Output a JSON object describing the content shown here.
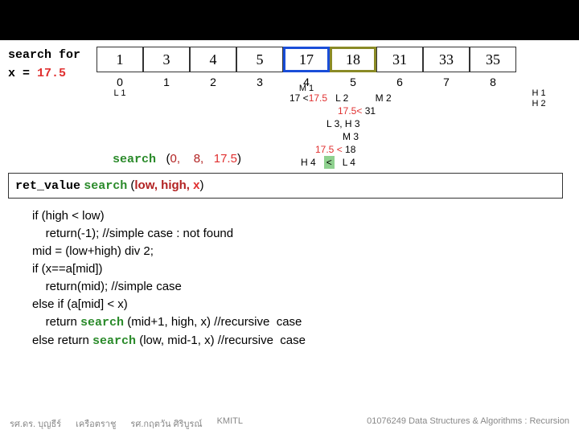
{
  "header": {
    "search_for": "search for",
    "x_label": "x",
    "equals": " = ",
    "x_value": "17.5"
  },
  "array": {
    "cells": [
      "1",
      "3",
      "4",
      "5",
      "17",
      "18",
      "31",
      "33",
      "35"
    ],
    "indices": [
      "0",
      "1",
      "2",
      "3",
      "4",
      "5",
      "6",
      "7",
      "8"
    ]
  },
  "ann": {
    "L1": "L 1",
    "M1": "M 1",
    "cmp1_a": "17 <",
    "cmp1_b": "17.5",
    "L2": "L 2",
    "M2": "M 2",
    "cmp2_a": "17.5<",
    "cmp2_b": "  31",
    "L3H3": "L 3, H 3",
    "M3": "M 3",
    "cmp3_a": "17.5 <",
    "cmp3_b": "  18",
    "H4": "H 4",
    "lt": "<",
    "L4": "L 4",
    "H1": "H 1",
    "H2": "H 2"
  },
  "call": {
    "label": "search",
    "args_open": "(",
    "arg_low": "0,",
    "arg_high": "8,",
    "arg_x": "17.5",
    "args_close": ")"
  },
  "ret": {
    "ret_value": "ret_value",
    "label": "search",
    "open": "(",
    "low": "low,",
    "high": "high,",
    "x": "x",
    "close": ")"
  },
  "code": {
    "l1": "if (high < low)",
    "l2": "    return(-1); //simple case : not found",
    "l3": "mid = (low+high) div 2;",
    "l4": "if (x==a[mid])",
    "l5": "    return(mid); //simple case",
    "l6": "else if (a[mid] < x)",
    "l7a": "    return ",
    "l7k": "search",
    "l7b": " (mid+1, high, x) //recursive  case",
    "l8a": "else return ",
    "l8k": "search",
    "l8b": " (low, mid-1, x) //recursive  case"
  },
  "footer": {
    "a": "รศ.ดร. บุญธีร์",
    "b": "เครือตราชู",
    "c": "รศ.กฤตวัน  ศิริบูรณ์",
    "d": "KMITL",
    "e": "01076249 Data Structures & Algorithms : Recursion"
  }
}
